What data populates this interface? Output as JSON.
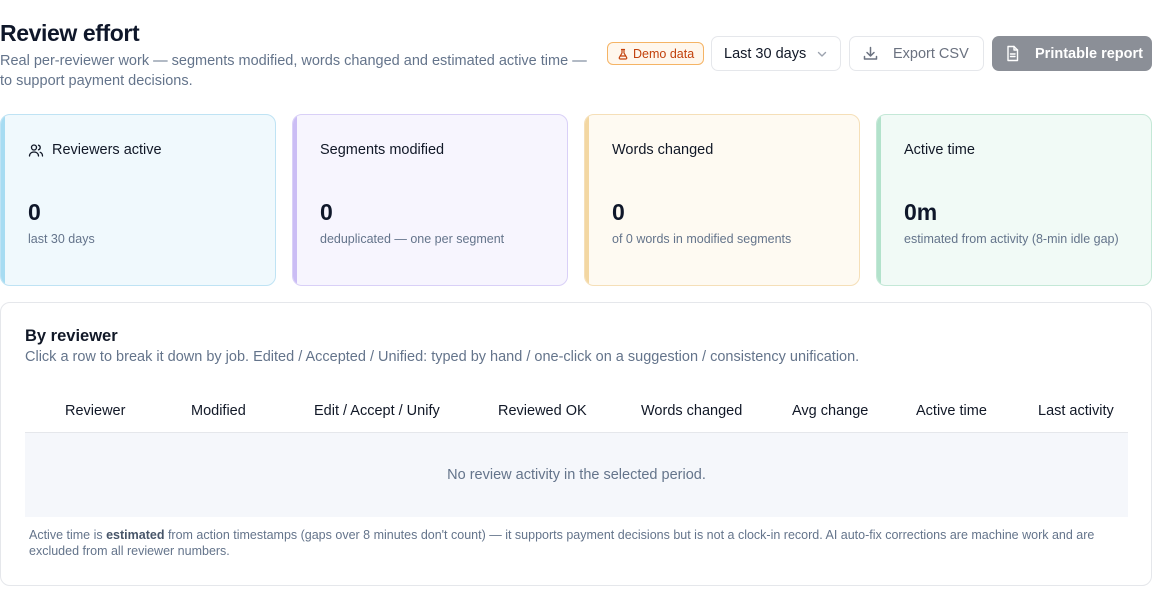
{
  "header": {
    "title": "Review effort",
    "subtitle": "Real per-reviewer work — segments modified, words changed and estimated active time — to support payment decisions.",
    "badge_label": "Demo data",
    "period_select": "Last 30 days",
    "export_label": "Export CSV",
    "print_label": "Printable report"
  },
  "cards": [
    {
      "label": "Reviewers active",
      "value": "0",
      "sub": "last 30 days"
    },
    {
      "label": "Segments modified",
      "value": "0",
      "sub": "deduplicated — one per segment"
    },
    {
      "label": "Words changed",
      "value": "0",
      "sub": "of 0 words in modified segments"
    },
    {
      "label": "Active time",
      "value": "0m",
      "sub": "estimated from activity (8-min idle gap)"
    }
  ],
  "by_reviewer": {
    "title": "By reviewer",
    "description": "Click a row to break it down by job. Edited / Accepted / Unified: typed by hand / one-click on a suggestion / consistency unification.",
    "columns": [
      "Reviewer",
      "Modified",
      "Edit / Accept / Unify",
      "Reviewed OK",
      "Words changed",
      "Avg change",
      "Active time",
      "Last activity"
    ],
    "empty_message": "No review activity in the selected period."
  },
  "footnote": {
    "prefix": "Active time is ",
    "bold": "estimated",
    "suffix": " from action timestamps (gaps over 8 minutes don't count) — it supports payment decisions but is not a clock-in record. AI auto-fix corrections are machine work and are excluded from all reviewer numbers."
  },
  "colors": {
    "badge": "#c2410c",
    "print_button": "#8b8f97",
    "card_blue": "#f0f9fd",
    "card_purple": "#f7f5fe",
    "card_orange": "#fefaf2",
    "card_green": "#f1faf6"
  },
  "icons": [
    "flask-icon",
    "chevron-down-icon",
    "download-icon",
    "document-icon",
    "users-icon"
  ]
}
